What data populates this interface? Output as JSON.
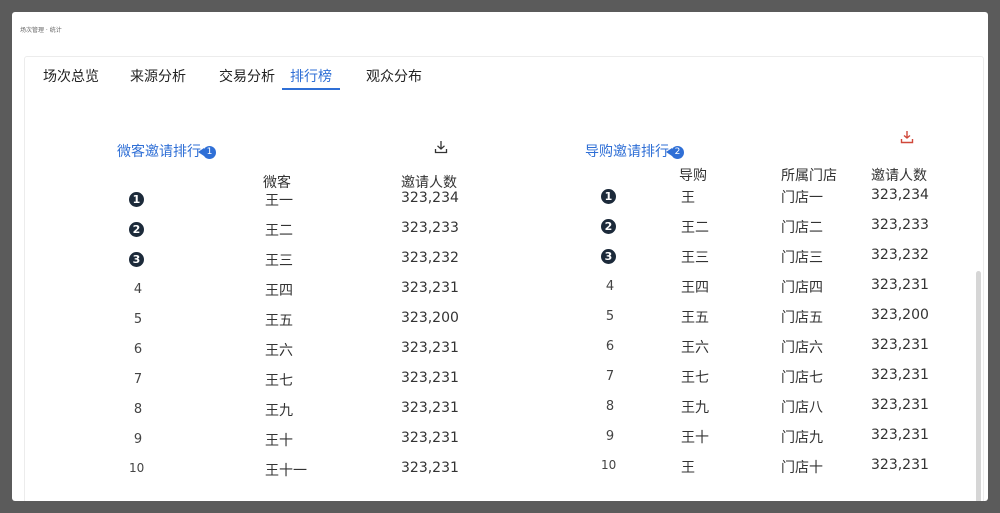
{
  "breadcrumb": "场次管理 · 统计",
  "tabs": [
    {
      "label": "场次总览"
    },
    {
      "label": "来源分析"
    },
    {
      "label": "交易分析"
    },
    {
      "label": "排行榜",
      "active": true
    },
    {
      "label": "观众分布"
    }
  ],
  "left": {
    "title": "微客邀请排行",
    "badge": "1",
    "download_icon": "download-icon",
    "columns": {
      "name": "微客",
      "count": "邀请人数"
    },
    "rows": [
      {
        "rank": "1",
        "name": "王一",
        "count": "323,234"
      },
      {
        "rank": "2",
        "name": "王二",
        "count": "323,233"
      },
      {
        "rank": "3",
        "name": "王三",
        "count": "323,232"
      },
      {
        "rank": "4",
        "name": "王四",
        "count": "323,231"
      },
      {
        "rank": "5",
        "name": "王五",
        "count": "323,200"
      },
      {
        "rank": "6",
        "name": "王六",
        "count": "323,231"
      },
      {
        "rank": "7",
        "name": "王七",
        "count": "323,231"
      },
      {
        "rank": "8",
        "name": "王九",
        "count": "323,231"
      },
      {
        "rank": "9",
        "name": "王十",
        "count": "323,231"
      },
      {
        "rank": "10",
        "name": "王十一",
        "count": "323,231"
      }
    ]
  },
  "right": {
    "title": "导购邀请排行",
    "badge": "2",
    "download_icon": "download-icon",
    "columns": {
      "name": "导购",
      "store": "所属门店",
      "count": "邀请人数"
    },
    "rows": [
      {
        "rank": "1",
        "name": "王",
        "store": "门店一",
        "count": "323,234"
      },
      {
        "rank": "2",
        "name": "王二",
        "store": "门店二",
        "count": "323,233"
      },
      {
        "rank": "3",
        "name": "王三",
        "store": "门店三",
        "count": "323,232"
      },
      {
        "rank": "4",
        "name": "王四",
        "store": "门店四",
        "count": "323,231"
      },
      {
        "rank": "5",
        "name": "王五",
        "store": "门店五",
        "count": "323,200"
      },
      {
        "rank": "6",
        "name": "王六",
        "store": "门店六",
        "count": "323,231"
      },
      {
        "rank": "7",
        "name": "王七",
        "store": "门店七",
        "count": "323,231"
      },
      {
        "rank": "8",
        "name": "王九",
        "store": "门店八",
        "count": "323,231"
      },
      {
        "rank": "9",
        "name": "王十",
        "store": "门店九",
        "count": "323,231"
      },
      {
        "rank": "10",
        "name": "王",
        "store": "门店十",
        "count": "323,231"
      }
    ]
  },
  "colors": {
    "accent": "#2f6fd6",
    "top_rank": "#1c2a3a",
    "export_icon": "#d0483a"
  }
}
